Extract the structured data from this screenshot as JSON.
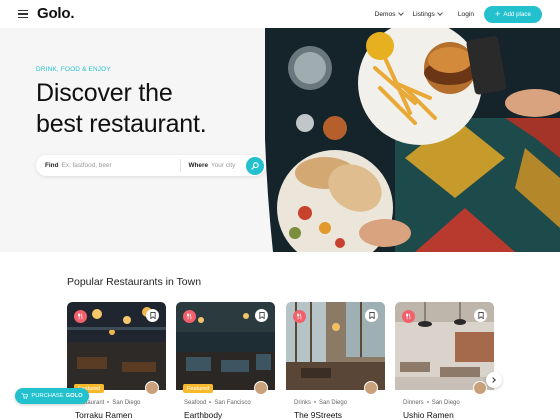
{
  "header": {
    "logo": "Golo.",
    "nav": [
      {
        "label": "Demos",
        "has_dropdown": true
      },
      {
        "label": "Listings",
        "has_dropdown": true
      }
    ],
    "login": "Login",
    "add_place": "Add place"
  },
  "hero": {
    "tagline": "DRINK, FOOD & ENJOY",
    "title_line1": "Discover the",
    "title_line2": "best restaurant.",
    "search": {
      "find_label": "Find",
      "find_placeholder": "Ex: fastfood, beer",
      "where_label": "Where",
      "where_placeholder": "Your city"
    }
  },
  "section": {
    "title": "Popular Restaurants in Town"
  },
  "cards": [
    {
      "category": "Restaurant",
      "city": "San Diego",
      "name": "Torraku Ramen",
      "featured": "Featured",
      "icon": "fork-knife-icon"
    },
    {
      "category": "Seafood",
      "city": "San Fancisco",
      "name": "Earthbody",
      "featured": "Featured",
      "icon": "fork-knife-icon"
    },
    {
      "category": "Drinks",
      "city": "San Diego",
      "name": "The 9Streets",
      "featured": "",
      "icon": "fork-knife-icon"
    },
    {
      "category": "Dinners",
      "city": "San Diego",
      "name": "Ushio Ramen",
      "featured": "",
      "icon": "fork-knife-icon"
    }
  ],
  "purchase": {
    "prefix": "PURCHASE",
    "brand": "GOLO"
  },
  "colors": {
    "accent": "#23c1ce",
    "category": "#f2606b",
    "featured": "#f8b92d"
  }
}
